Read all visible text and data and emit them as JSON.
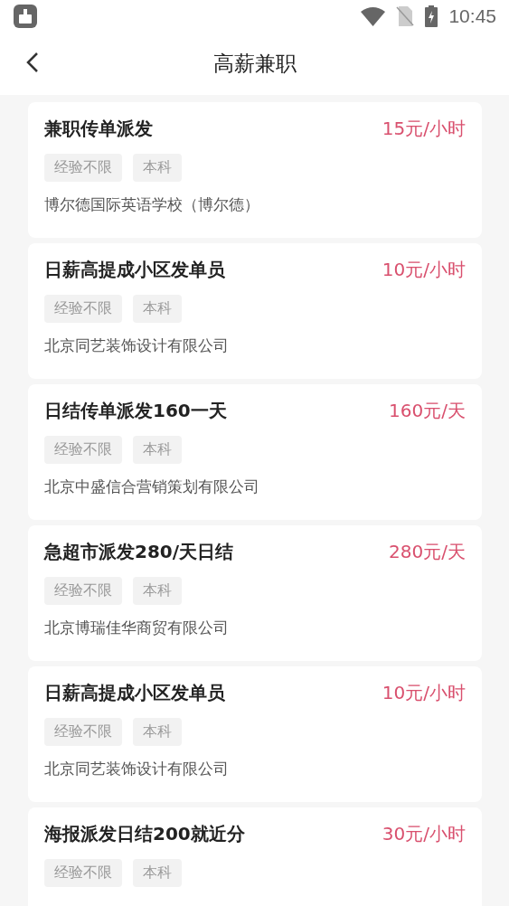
{
  "status_bar": {
    "time": "10:45"
  },
  "header": {
    "title": "高薪兼职"
  },
  "jobs": [
    {
      "title": "兼职传单派发",
      "pay": "15元/小时",
      "tags": [
        "经验不限",
        "本科"
      ],
      "company": "博尔德国际英语学校（博尔德）"
    },
    {
      "title": "日薪高提成小区发单员",
      "pay": "10元/小时",
      "tags": [
        "经验不限",
        "本科"
      ],
      "company": "北京同艺装饰设计有限公司"
    },
    {
      "title": "日结传单派发160一天",
      "pay": "160元/天",
      "tags": [
        "经验不限",
        "本科"
      ],
      "company": "北京中盛信合营销策划有限公司"
    },
    {
      "title": "急超市派发280/天日结",
      "pay": "280元/天",
      "tags": [
        "经验不限",
        "本科"
      ],
      "company": "北京博瑞佳华商贸有限公司"
    },
    {
      "title": "日薪高提成小区发单员",
      "pay": "10元/小时",
      "tags": [
        "经验不限",
        "本科"
      ],
      "company": "北京同艺装饰设计有限公司"
    },
    {
      "title": "海报派发日结200就近分",
      "pay": "30元/小时",
      "tags": [
        "经验不限",
        "本科"
      ]
    }
  ]
}
